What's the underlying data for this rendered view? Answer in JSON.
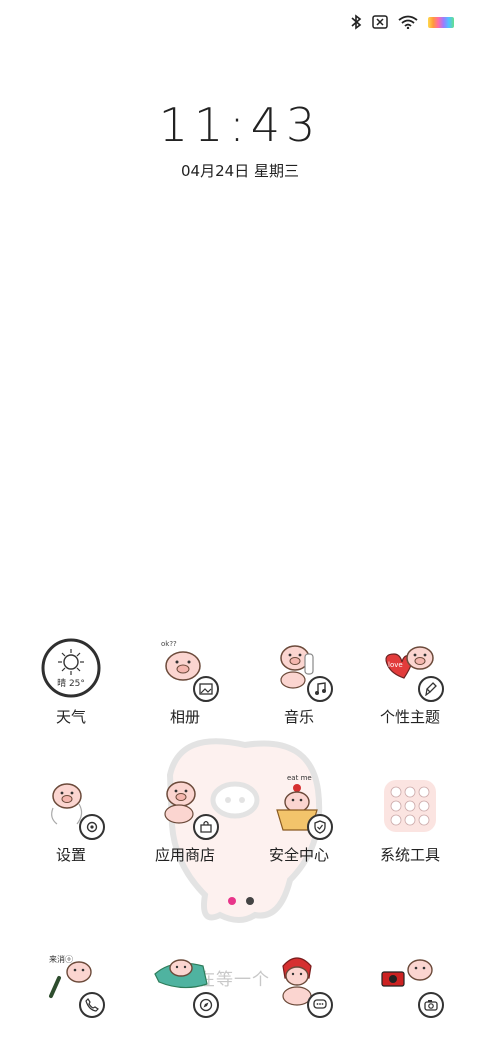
{
  "status_bar": {
    "icons": [
      "bluetooth-icon",
      "no-sim-icon",
      "wifi-icon",
      "battery-icon"
    ]
  },
  "lockscreen": {
    "time": "11:43",
    "date": "04月24日 星期三",
    "bg_text": "在等一个"
  },
  "weather_widget": {
    "text": "晴 25°"
  },
  "apps": [
    {
      "label": "天气",
      "icon": "weather-sun-icon"
    },
    {
      "label": "相册",
      "icon": "gallery-pig-icon"
    },
    {
      "label": "音乐",
      "icon": "music-pig-icon"
    },
    {
      "label": "个性主题",
      "icon": "theme-pig-icon"
    },
    {
      "label": "设置",
      "icon": "settings-pig-icon"
    },
    {
      "label": "应用商店",
      "icon": "app-store-pig-icon"
    },
    {
      "label": "安全中心",
      "icon": "security-pig-icon"
    },
    {
      "label": "系统工具",
      "icon": "system-tools-folder-icon"
    }
  ],
  "dock": [
    {
      "icon": "phone-pig-icon"
    },
    {
      "icon": "browser-pig-icon"
    },
    {
      "icon": "messages-pig-icon"
    },
    {
      "icon": "camera-pig-icon"
    }
  ],
  "page_indicator": {
    "active_color": "#e8358a",
    "inactive_color": "#444444"
  },
  "theme": {
    "pig_fill": "#fbd5d0",
    "pig_outline": "#6b4a3a",
    "accent_green": "#2e7d5b"
  }
}
